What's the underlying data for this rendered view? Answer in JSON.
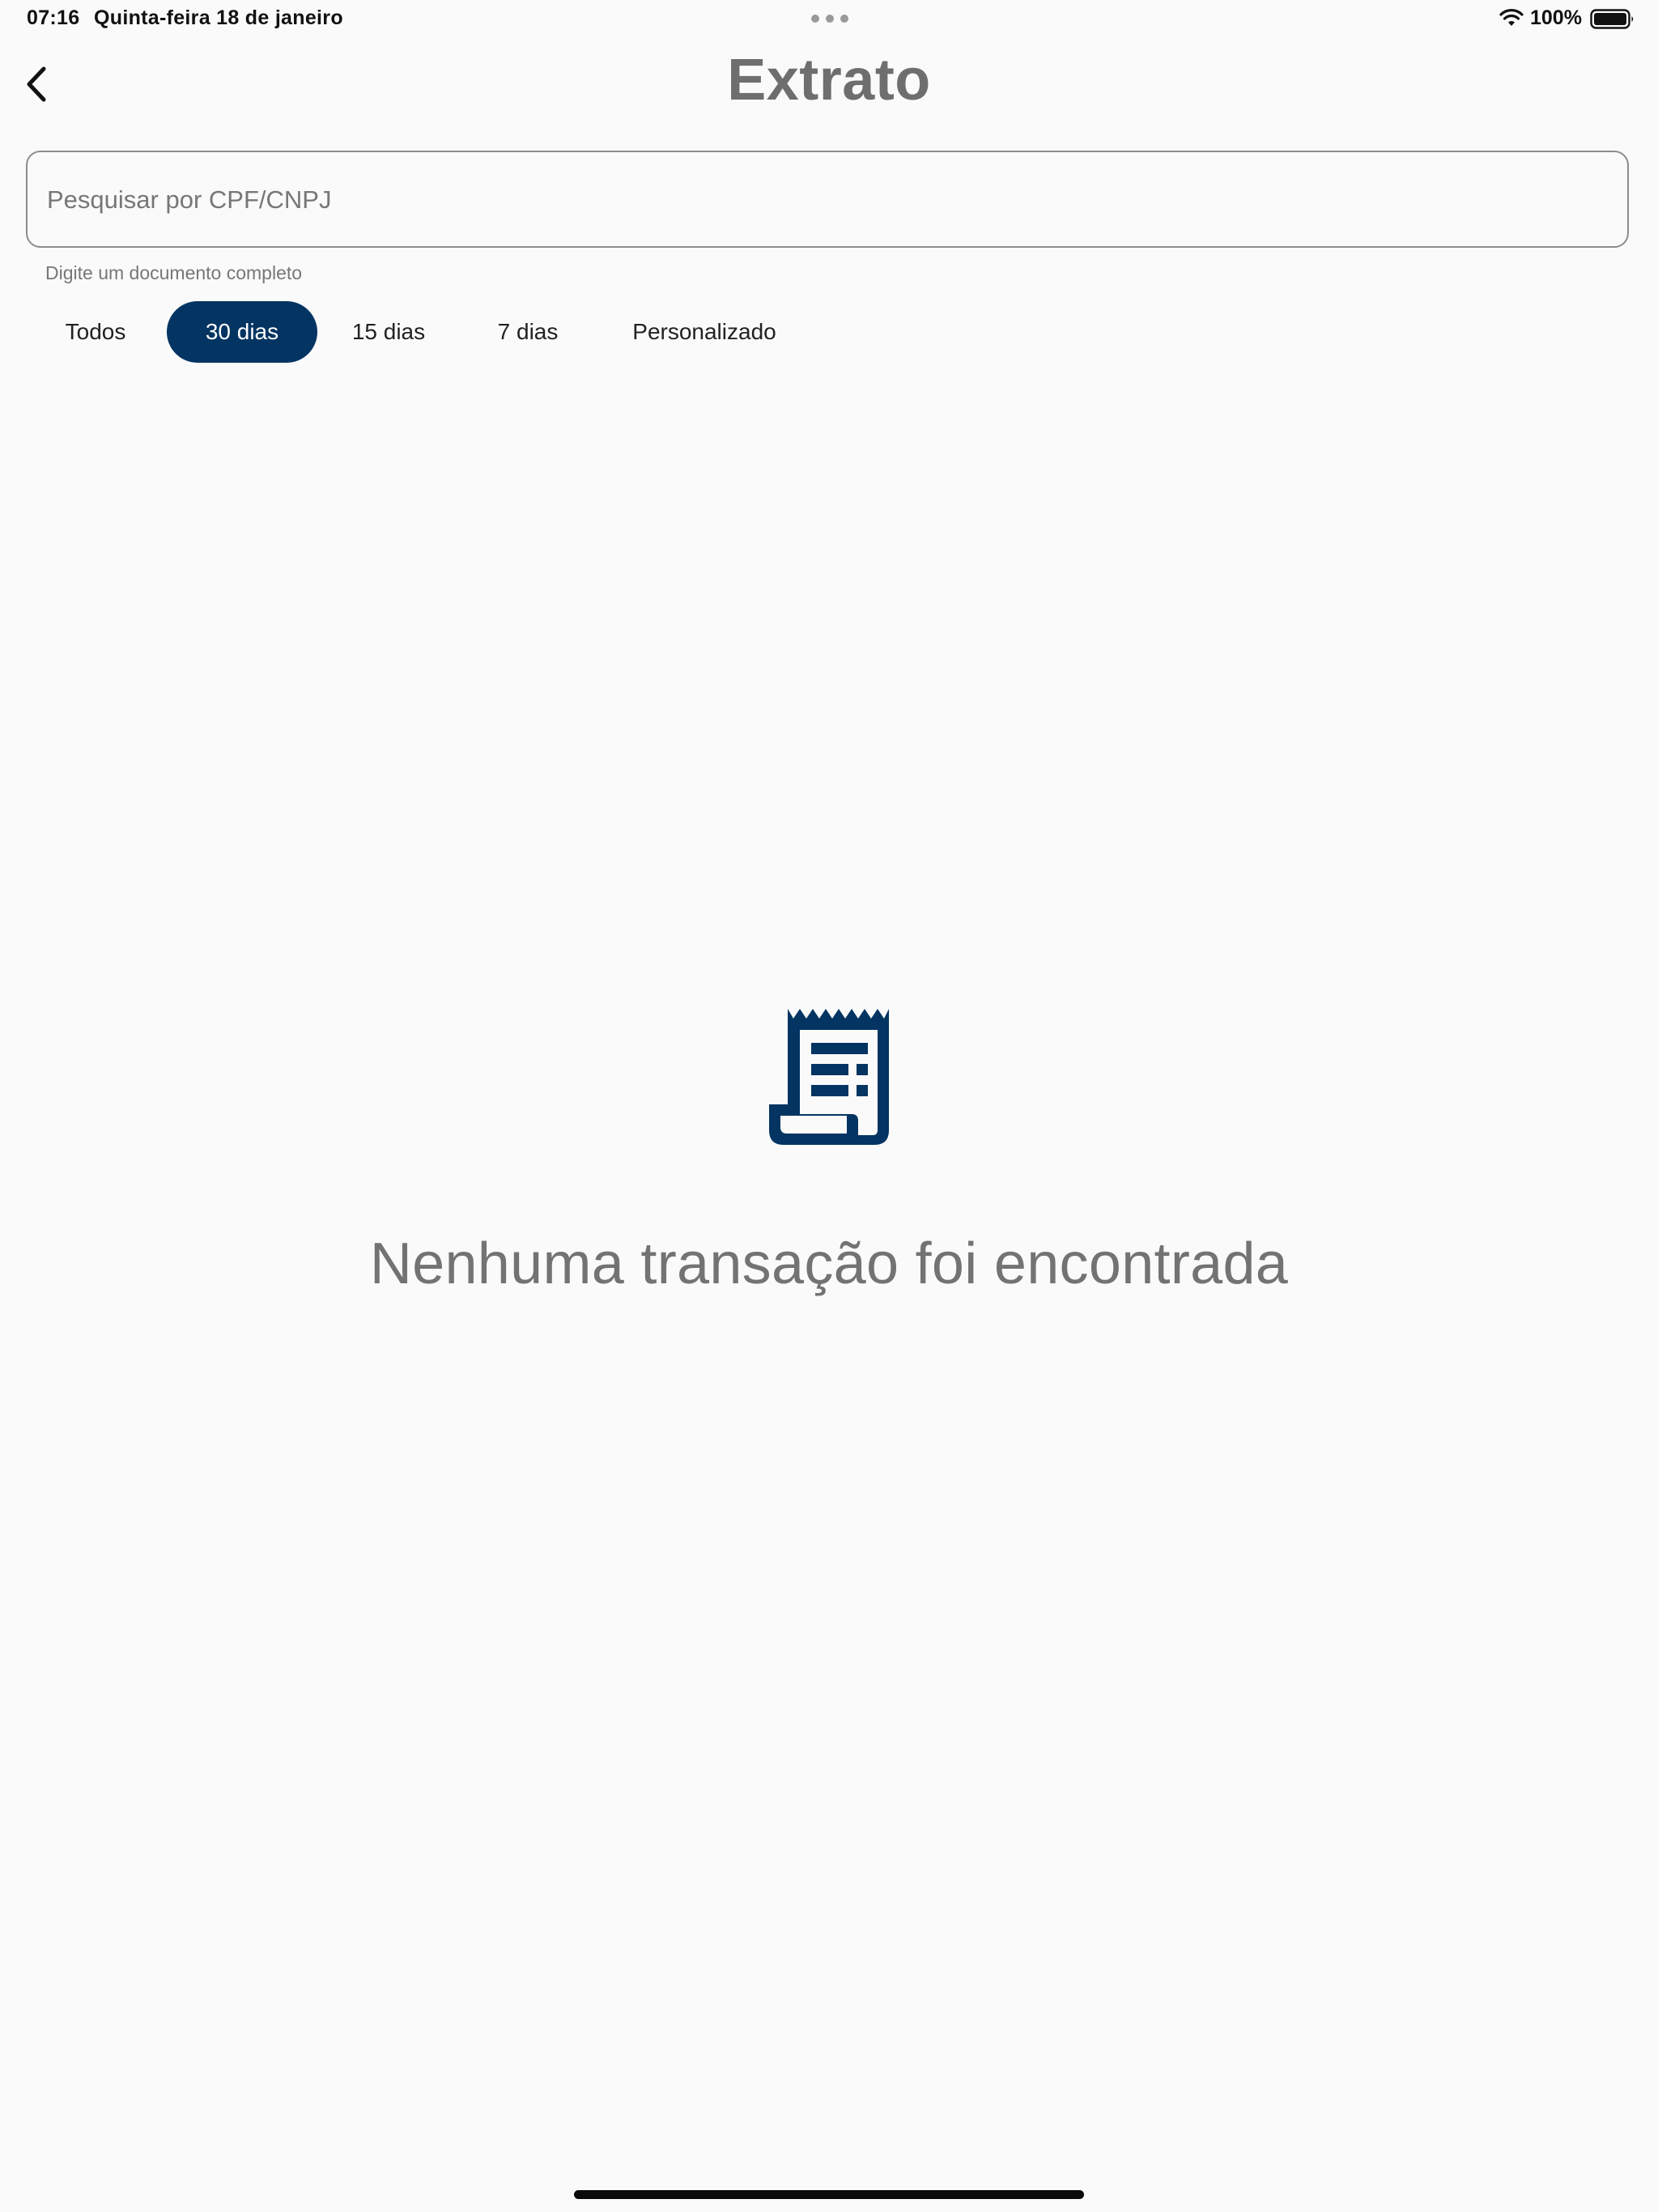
{
  "status_bar": {
    "time": "07:16",
    "date": "Quinta-feira 18 de janeiro",
    "battery": "100%"
  },
  "header": {
    "title": "Extrato",
    "back_icon": "chevron-left-icon"
  },
  "search": {
    "placeholder": "Pesquisar por CPF/CNPJ",
    "value": "",
    "helper": "Digite um documento completo"
  },
  "filters": {
    "selected": "30 dias",
    "items": [
      {
        "label": "Todos"
      },
      {
        "label": "30 dias"
      },
      {
        "label": "15 dias"
      },
      {
        "label": "7 dias"
      },
      {
        "label": "Personalizado"
      }
    ]
  },
  "empty_state": {
    "icon": "receipt-icon",
    "message": "Nenhuma transação foi encontrada"
  },
  "colors": {
    "accent": "#033462",
    "title": "#6e6e6e",
    "background": "#fafafa"
  }
}
